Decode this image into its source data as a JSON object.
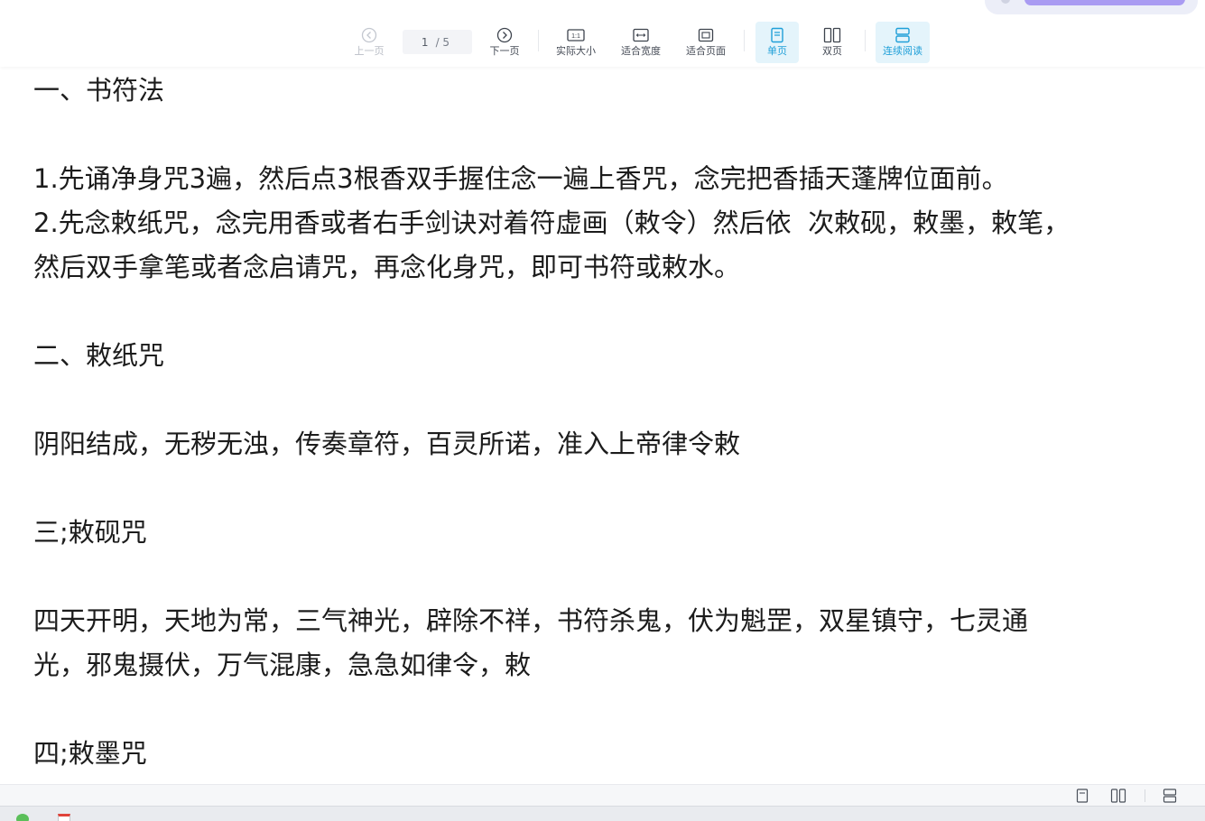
{
  "toolbar": {
    "prev_label": "上一页",
    "next_label": "下一页",
    "page_current": "1",
    "page_total": "/ 5",
    "actual_size_label": "实际大小",
    "actual_size_glyph": "1:1",
    "fit_width_label": "适合宽度",
    "fit_page_label": "适合页面",
    "single_page_label": "单页",
    "double_page_label": "双页",
    "continuous_label": "连续阅读"
  },
  "document": {
    "lines": [
      "一、书符法",
      "",
      "1.先诵净身咒3遍，然后点3根香双手握住念一遍上香咒，念完把香插天蓬牌位面前。",
      "2.先念敕纸咒，念完用香或者右手剑诀对着符虚画（敕令）然后依  次敕砚，敕墨，敕笔，",
      "然后双手拿笔或者念启请咒，再念化身咒，即可书符或敕水。",
      "",
      "二、敕纸咒",
      "",
      "阴阳结成，无秽无浊，传奏章符，百灵所诺，准入上帝律令敕",
      "",
      "三;敕砚咒",
      "",
      "四天开明，天地为常，三气神光，辟除不祥，书符杀鬼，伏为魁罡，双星镇守，七灵通",
      "光，邪鬼摄伏，万气混康，急急如律令，敕",
      "",
      "四;敕墨咒"
    ]
  },
  "colors": {
    "accent": "#1f9fd8",
    "active_bg": "#e4f4fb",
    "text": "#1c1c1c"
  }
}
